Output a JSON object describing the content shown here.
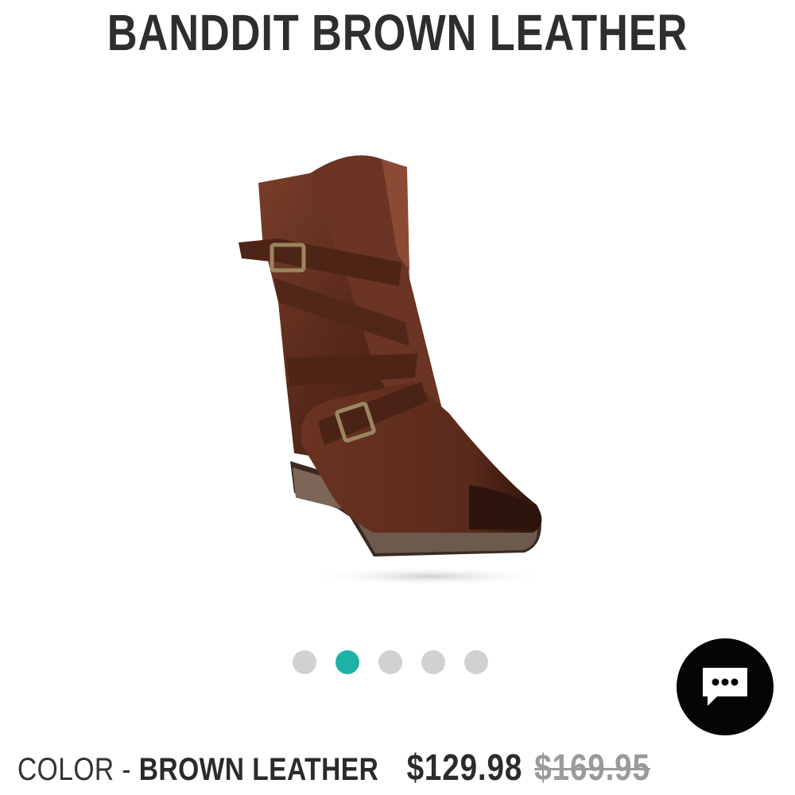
{
  "product": {
    "title": "BANDDIT BROWN LEATHER",
    "color_prefix": "COLOR - ",
    "color_value": "BROWN LEATHER",
    "sale_price": "$129.98",
    "original_price": "$169.95"
  },
  "carousel": {
    "dot_count": 5,
    "active_index": 1,
    "dot_color": "#d1d1d1",
    "active_color": "#1fb3a8"
  },
  "chat": {
    "icon": "chat-bubble-icon",
    "background": "#050505"
  },
  "image": {
    "subject": "brown leather buckled boot"
  }
}
